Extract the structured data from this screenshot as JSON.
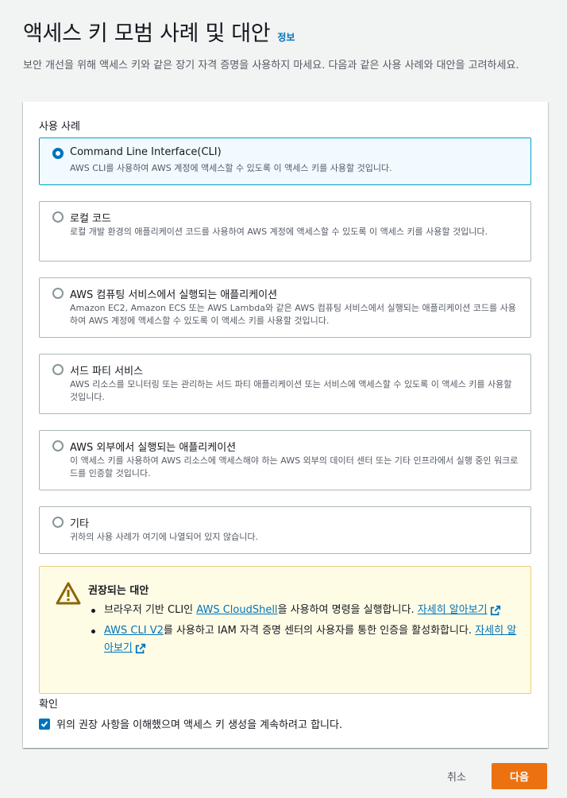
{
  "header": {
    "title": "액세스 키 모범 사례 및 대안",
    "info_link": "정보",
    "description": "보안 개선을 위해 액세스 키와 같은 장기 자격 증명을 사용하지 마세요. 다음과 같은 사용 사례와 대안을 고려하세요."
  },
  "use_cases": {
    "label": "사용 사례",
    "selected_index": 0,
    "options": [
      {
        "title": "Command Line Interface(CLI)",
        "description": "AWS CLI를 사용하여 AWS 계정에 액세스할 수 있도록 이 액세스 키를 사용할 것입니다."
      },
      {
        "title": "로컬 코드",
        "description": "로컬 개발 환경의 애플리케이션 코드를 사용하여 AWS 계정에 액세스할 수 있도록 이 액세스 키를 사용할 것입니다."
      },
      {
        "title": "AWS 컴퓨팅 서비스에서 실행되는 애플리케이션",
        "description": "Amazon EC2, Amazon ECS 또는 AWS Lambda와 같은 AWS 컴퓨팅 서비스에서 실행되는 애플리케이션 코드를 사용하여 AWS 계정에 액세스할 수 있도록 이 액세스 키를 사용할 것입니다."
      },
      {
        "title": "서드 파티 서비스",
        "description": "AWS 리소스를 모니터링 또는 관리하는 서드 파티 애플리케이션 또는 서비스에 액세스할 수 있도록 이 액세스 키를 사용할 것입니다."
      },
      {
        "title": "AWS 외부에서 실행되는 애플리케이션",
        "description": "이 액세스 키를 사용하여 AWS 리소스에 액세스해야 하는 AWS 외부의 데이터 센터 또는 기타 인프라에서 실행 중인 워크로드를 인증할 것입니다."
      },
      {
        "title": "기타",
        "description": "귀하의 사용 사례가 여기에 나열되어 있지 않습니다."
      }
    ]
  },
  "alert": {
    "title": "권장되는 대안",
    "item1_prefix": "브라우저 기반 CLI인 ",
    "item1_link": "AWS CloudShell",
    "item1_suffix": "을 사용하여 명령을 실행합니다. ",
    "item1_learn_more": "자세히 알아보기",
    "item2_link": "AWS CLI V2",
    "item2_suffix": "를 사용하고 IAM 자격 증명 센터의 사용자를 통한 인증을 활성화합니다. ",
    "item2_learn_more": "자세히 알아보기"
  },
  "confirmation": {
    "label": "확인",
    "checkbox_text": "위의 권장 사항을 이해했으며 액세스 키 생성을 계속하려고 합니다.",
    "checked": true
  },
  "footer": {
    "cancel_label": "취소",
    "next_label": "다음"
  },
  "colors": {
    "primary_button": "#ec7211",
    "link": "#0073bb",
    "selected_border": "#00a1c9",
    "warning_bg": "#fffce6"
  }
}
